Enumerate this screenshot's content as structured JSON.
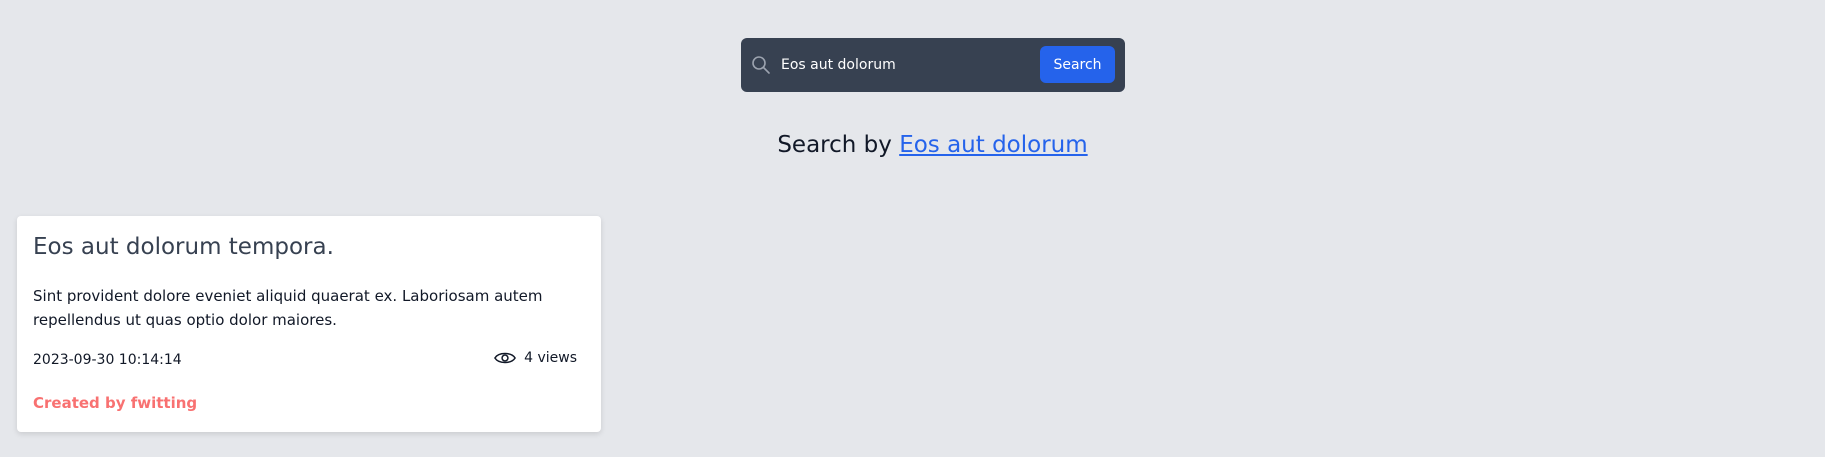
{
  "search": {
    "value": "Eos aut dolorum",
    "button_label": "Search"
  },
  "heading": {
    "prefix": "Search by ",
    "term": "Eos aut dolorum"
  },
  "card": {
    "title": "Eos aut dolorum tempora.",
    "body": "Sint provident dolore eveniet aliquid quaerat ex. Laboriosam autem repellendus ut quas optio dolor maiores.",
    "date": "2023-09-30 10:14:14",
    "views": "4 views",
    "author": "Created by fwitting"
  },
  "colors": {
    "background": "#e5e7eb",
    "search_bar": "#374151",
    "accent": "#2563eb",
    "author": "#f87171"
  }
}
